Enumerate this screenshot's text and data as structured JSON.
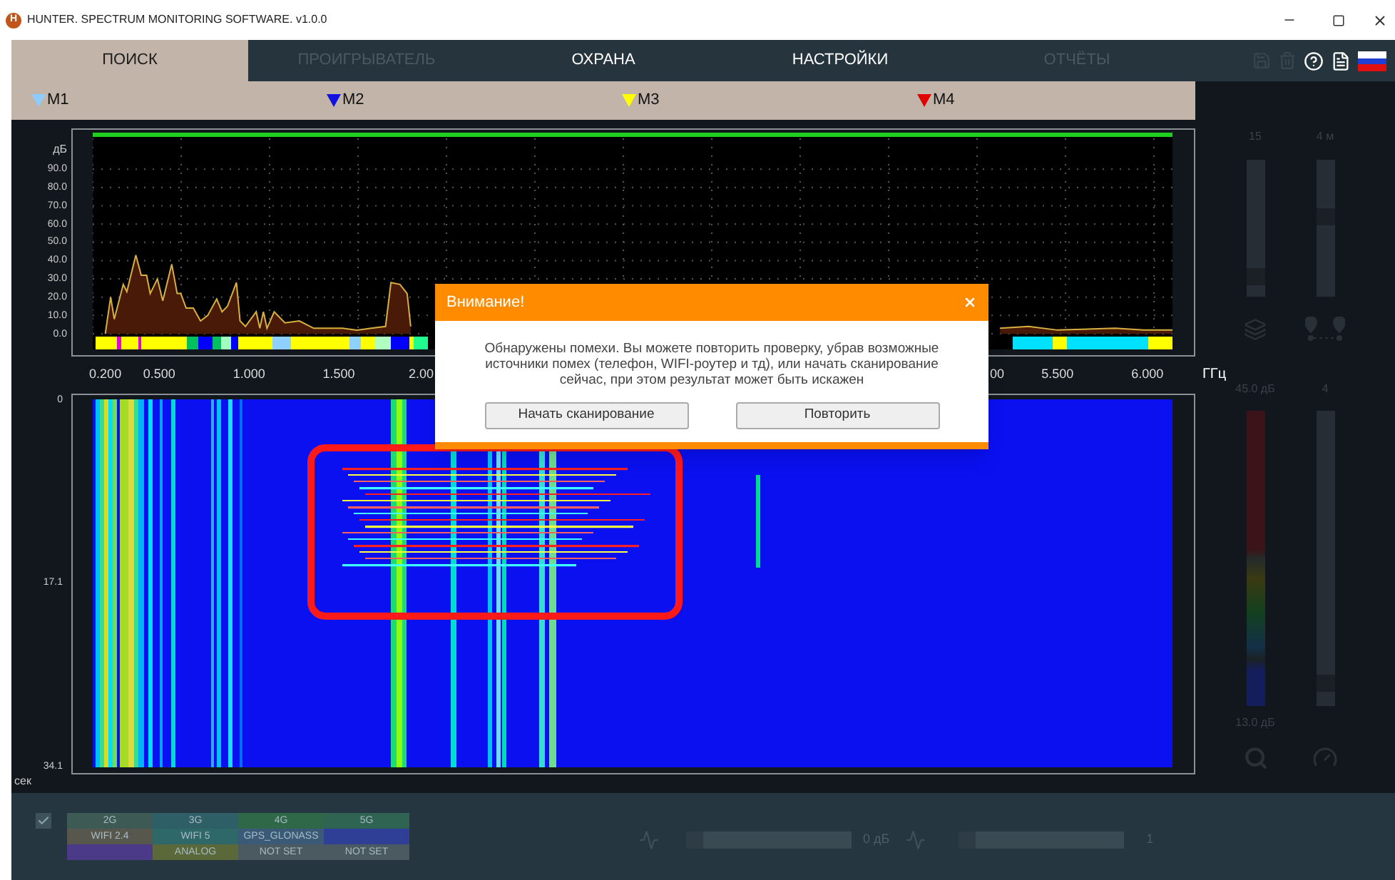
{
  "window": {
    "app_icon_letter": "H",
    "title": "HUNTER. SPECTRUM MONITORING SOFTWARE. v1.0.0"
  },
  "tabs": [
    {
      "label": "ПОИСК",
      "selected": true,
      "disabled": false
    },
    {
      "label": "ПРОИГРЫВАТЕЛЬ",
      "selected": false,
      "disabled": true
    },
    {
      "label": "ОХРАНА",
      "selected": false,
      "disabled": false
    },
    {
      "label": "НАСТРОЙКИ",
      "selected": false,
      "disabled": false
    },
    {
      "label": "ОТЧЁТЫ",
      "selected": false,
      "disabled": true
    }
  ],
  "toolbar_icons": [
    {
      "kind": "save",
      "disabled": true
    },
    {
      "kind": "delete",
      "disabled": true
    },
    {
      "kind": "help",
      "disabled": false
    },
    {
      "kind": "document",
      "disabled": false
    },
    {
      "kind": "flag",
      "disabled": false
    }
  ],
  "markers": [
    {
      "label": "M1",
      "color": "#8ecbff"
    },
    {
      "label": "M2",
      "color": "#1010e0"
    },
    {
      "label": "M3",
      "color": "#ffff00"
    },
    {
      "label": "M4",
      "color": "#e00000"
    }
  ],
  "spectrum": {
    "chart_data": {
      "type": "area",
      "xlabel": "ГГц",
      "ylabel": "дБ",
      "xlim": [
        0.13,
        6.14
      ],
      "ylim": [
        0,
        110
      ],
      "grid": true,
      "x": [
        0.2,
        0.23,
        0.25,
        0.3,
        0.32,
        0.37,
        0.4,
        0.43,
        0.45,
        0.49,
        0.52,
        0.57,
        0.6,
        0.62,
        0.65,
        0.69,
        0.73,
        0.77,
        0.82,
        0.85,
        0.88,
        0.93,
        0.95,
        0.98,
        1.04,
        1.06,
        1.08,
        1.1,
        1.14,
        1.2,
        1.28,
        1.36,
        1.52,
        1.6,
        1.68,
        1.76,
        1.79,
        1.84,
        1.88,
        1.9,
        2.08,
        2.79,
        3.59,
        4.39,
        5.18,
        5.34,
        5.5,
        5.82,
        5.98,
        6.14
      ],
      "series": [
        {
          "color": "#d8b040",
          "values": [
            0,
            20,
            8,
            27,
            23,
            43,
            32,
            32,
            22,
            30,
            18,
            38,
            22,
            22,
            14,
            14,
            7,
            10,
            19,
            12,
            15,
            28,
            7,
            4,
            12,
            3,
            12,
            3,
            12,
            6,
            7,
            3,
            3,
            2,
            3,
            4,
            28,
            27,
            22,
            4,
            null,
            null,
            null,
            null,
            3,
            4,
            2,
            3,
            2,
            2
          ]
        }
      ],
      "yticks": [
        {
          "value": 90,
          "label": "90.0"
        },
        {
          "value": 80,
          "label": "80.0"
        },
        {
          "value": 70,
          "label": "70.0"
        },
        {
          "value": 60,
          "label": "60.0"
        },
        {
          "value": 50,
          "label": "50.0"
        },
        {
          "value": 40,
          "label": "40.0"
        },
        {
          "value": 30,
          "label": "30.0"
        },
        {
          "value": 20,
          "label": "20.0"
        },
        {
          "value": 10,
          "label": "10.0"
        },
        {
          "value": 0,
          "label": "0.0"
        }
      ],
      "xticks": [
        {
          "value": 0.2,
          "label": "0.200"
        },
        {
          "value": 0.5,
          "label": "0.500"
        },
        {
          "value": 1.0,
          "label": "1.000"
        },
        {
          "value": 1.5,
          "label": "1.500"
        },
        {
          "value": 5.5,
          "label": "5.500"
        },
        {
          "value": 6.0,
          "label": "6.000"
        }
      ]
    },
    "x_label_fragments": [
      "2.00",
      "00"
    ]
  },
  "waterfall": {
    "y_labels": [
      "0",
      "17.1",
      "34.1"
    ],
    "y_unit": "сек"
  },
  "dialog": {
    "title": "Внимание!",
    "message": "Обнаружены помехи. Вы можете повторить проверку, убрав возможные источники помех (телефон, WIFI-роутер и тд), или начать сканирование сейчас, при этом результат может быть искажен",
    "buttons": [
      "Начать сканирование",
      "Повторить"
    ]
  },
  "sidebar": {
    "sliders": [
      {
        "reading": "15",
        "level": 0.1
      },
      {
        "reading": "4 м",
        "level": 0.6
      }
    ],
    "scale": {
      "max": "45.0 дБ",
      "min": "13.0 дБ"
    },
    "count_slider": {
      "reading": "4",
      "level": 0.05
    }
  },
  "bottom_panel": {
    "checked": true,
    "legend": [
      {
        "label": "2G",
        "color": "#3e5a54"
      },
      {
        "label": "3G",
        "color": "#2e5e66"
      },
      {
        "label": "4G",
        "color": "#2e6848"
      },
      {
        "label": "5G",
        "color": "#2f6452"
      },
      {
        "label": "WIFI 2.4",
        "color": "#58574e"
      },
      {
        "label": "WIFI 5",
        "color": "#2f6868"
      },
      {
        "label": "GPS_GLONASS",
        "color": "#3a5a78"
      },
      {
        "color": "#2f3f96"
      },
      {
        "color": "#4a3a88"
      },
      {
        "label": "ANALOG",
        "color": "#5a683a"
      },
      {
        "label": "NOT SET",
        "color": "#4a5a60"
      },
      {
        "label": "NOT SET",
        "color": "#4a5a60"
      }
    ],
    "gain": {
      "level": 0,
      "reading": "0 дБ"
    },
    "threshold": {
      "level": 0,
      "reading": "1"
    }
  }
}
